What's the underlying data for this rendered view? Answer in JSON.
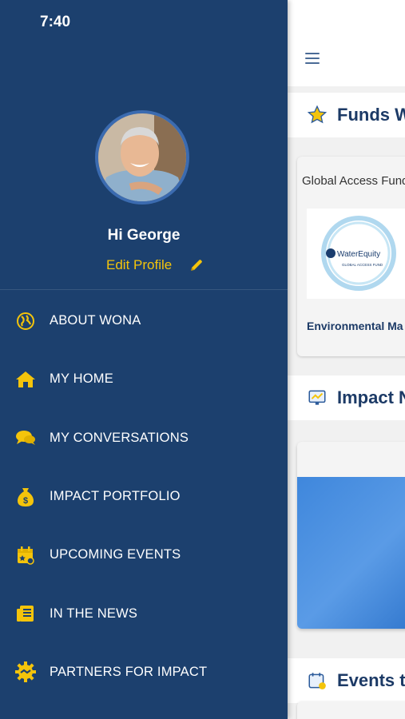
{
  "status_bar": {
    "time": "7:40"
  },
  "drawer": {
    "greeting": "Hi George",
    "edit_profile_label": "Edit Profile",
    "menu": [
      {
        "label": "ABOUT WONA",
        "icon": "globe-icon"
      },
      {
        "label": "MY HOME",
        "icon": "home-icon"
      },
      {
        "label": "MY CONVERSATIONS",
        "icon": "chat-bubbles-icon"
      },
      {
        "label": "IMPACT PORTFOLIO",
        "icon": "money-bag-icon"
      },
      {
        "label": "UPCOMING EVENTS",
        "icon": "calendar-icon"
      },
      {
        "label": "IN THE NEWS",
        "icon": "newspaper-icon"
      },
      {
        "label": "PARTNERS FOR IMPACT",
        "icon": "gear-handshake-icon"
      }
    ],
    "accent_color": "#f4c40b",
    "background_color": "#1c406e"
  },
  "main": {
    "sections": {
      "funds": {
        "title": "Funds Wa",
        "icon": "star-icon"
      },
      "impact": {
        "title": "Impact N",
        "icon": "monitor-chart-icon"
      },
      "events": {
        "title": "Events to",
        "icon": "calendar-check-icon"
      }
    },
    "funds_card": {
      "title": "Global Access Fund",
      "logo_text": "WaterEquity",
      "logo_subtext": "GLOBAL ACCESS FUND",
      "subtitle": "Environmental Ma"
    }
  }
}
